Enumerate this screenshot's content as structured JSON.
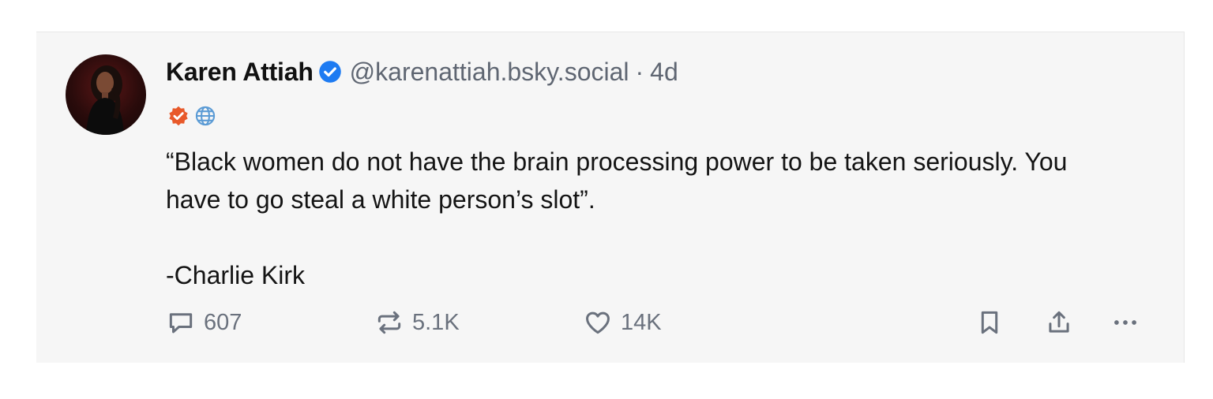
{
  "post": {
    "author": {
      "display_name": "Karen Attiah",
      "handle": "@karenattiah.bsky.social",
      "verified": true
    },
    "separator": "·",
    "timestamp": "4d",
    "badges": [
      "verified-check-badge-icon",
      "globe-icon"
    ],
    "text_lines": [
      "“Black women do not have the brain processing power to be taken seriously. You have to go steal a white person’s slot”.",
      "-Charlie Kirk"
    ],
    "actions": {
      "replies": "607",
      "reposts": "5.1K",
      "likes": "14K"
    },
    "icons": [
      "reply-icon",
      "repost-icon",
      "heart-icon",
      "bookmark-icon",
      "share-icon",
      "more-options-icon"
    ]
  },
  "colors": {
    "card_background": "#f6f6f6",
    "verified_blue": "#1d7bf2",
    "badge_orange": "#e8592a",
    "globe_blue": "#5b9bd5",
    "muted_text": "#5f6672"
  }
}
